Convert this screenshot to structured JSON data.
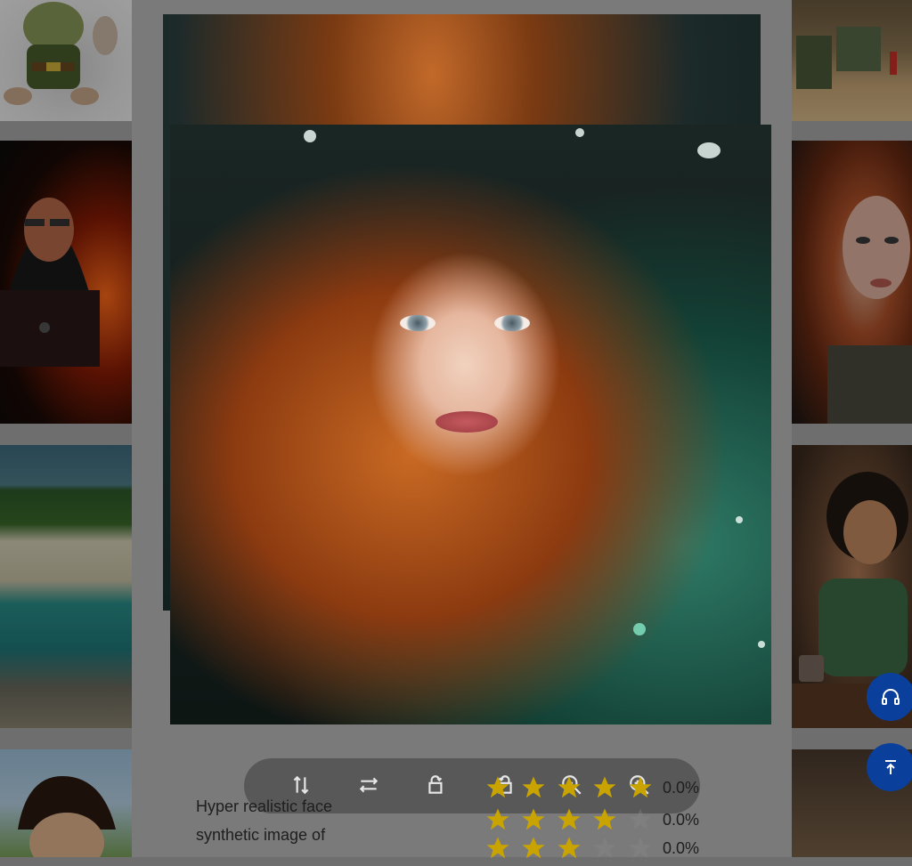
{
  "gallery": {
    "left_column": [
      {
        "name": "gnome-figurine"
      },
      {
        "name": "hooded-hacker-laptop"
      },
      {
        "name": "tropical-beach"
      },
      {
        "name": "cartoon-boy"
      }
    ],
    "right_column": [
      {
        "name": "desert-town-vehicles"
      },
      {
        "name": "red-haired-woman"
      },
      {
        "name": "cartoon-woman-cafe"
      },
      {
        "name": "interior-scene"
      }
    ]
  },
  "preview": {
    "toolbar": [
      {
        "icon": "flip-vertical-icon"
      },
      {
        "icon": "flip-horizontal-icon"
      },
      {
        "icon": "rotate-left-icon"
      },
      {
        "icon": "rotate-right-icon"
      },
      {
        "icon": "zoom-out-icon"
      },
      {
        "icon": "zoom-in-icon"
      }
    ],
    "caption_lines": [
      "Hyper realistic face",
      "synthetic image of"
    ],
    "ratings": [
      {
        "stars_filled": 5,
        "value": "0.0%"
      },
      {
        "stars_filled": 4,
        "value": "0.0%"
      },
      {
        "stars_filled": 3,
        "value": "0.0%"
      }
    ]
  },
  "fabs": [
    {
      "icon": "headphones-icon"
    },
    {
      "icon": "back-to-top-icon"
    }
  ],
  "colors": {
    "star": "#c9a400",
    "star_empty": "#8a8a8a",
    "fab": "#0a3f9c"
  }
}
